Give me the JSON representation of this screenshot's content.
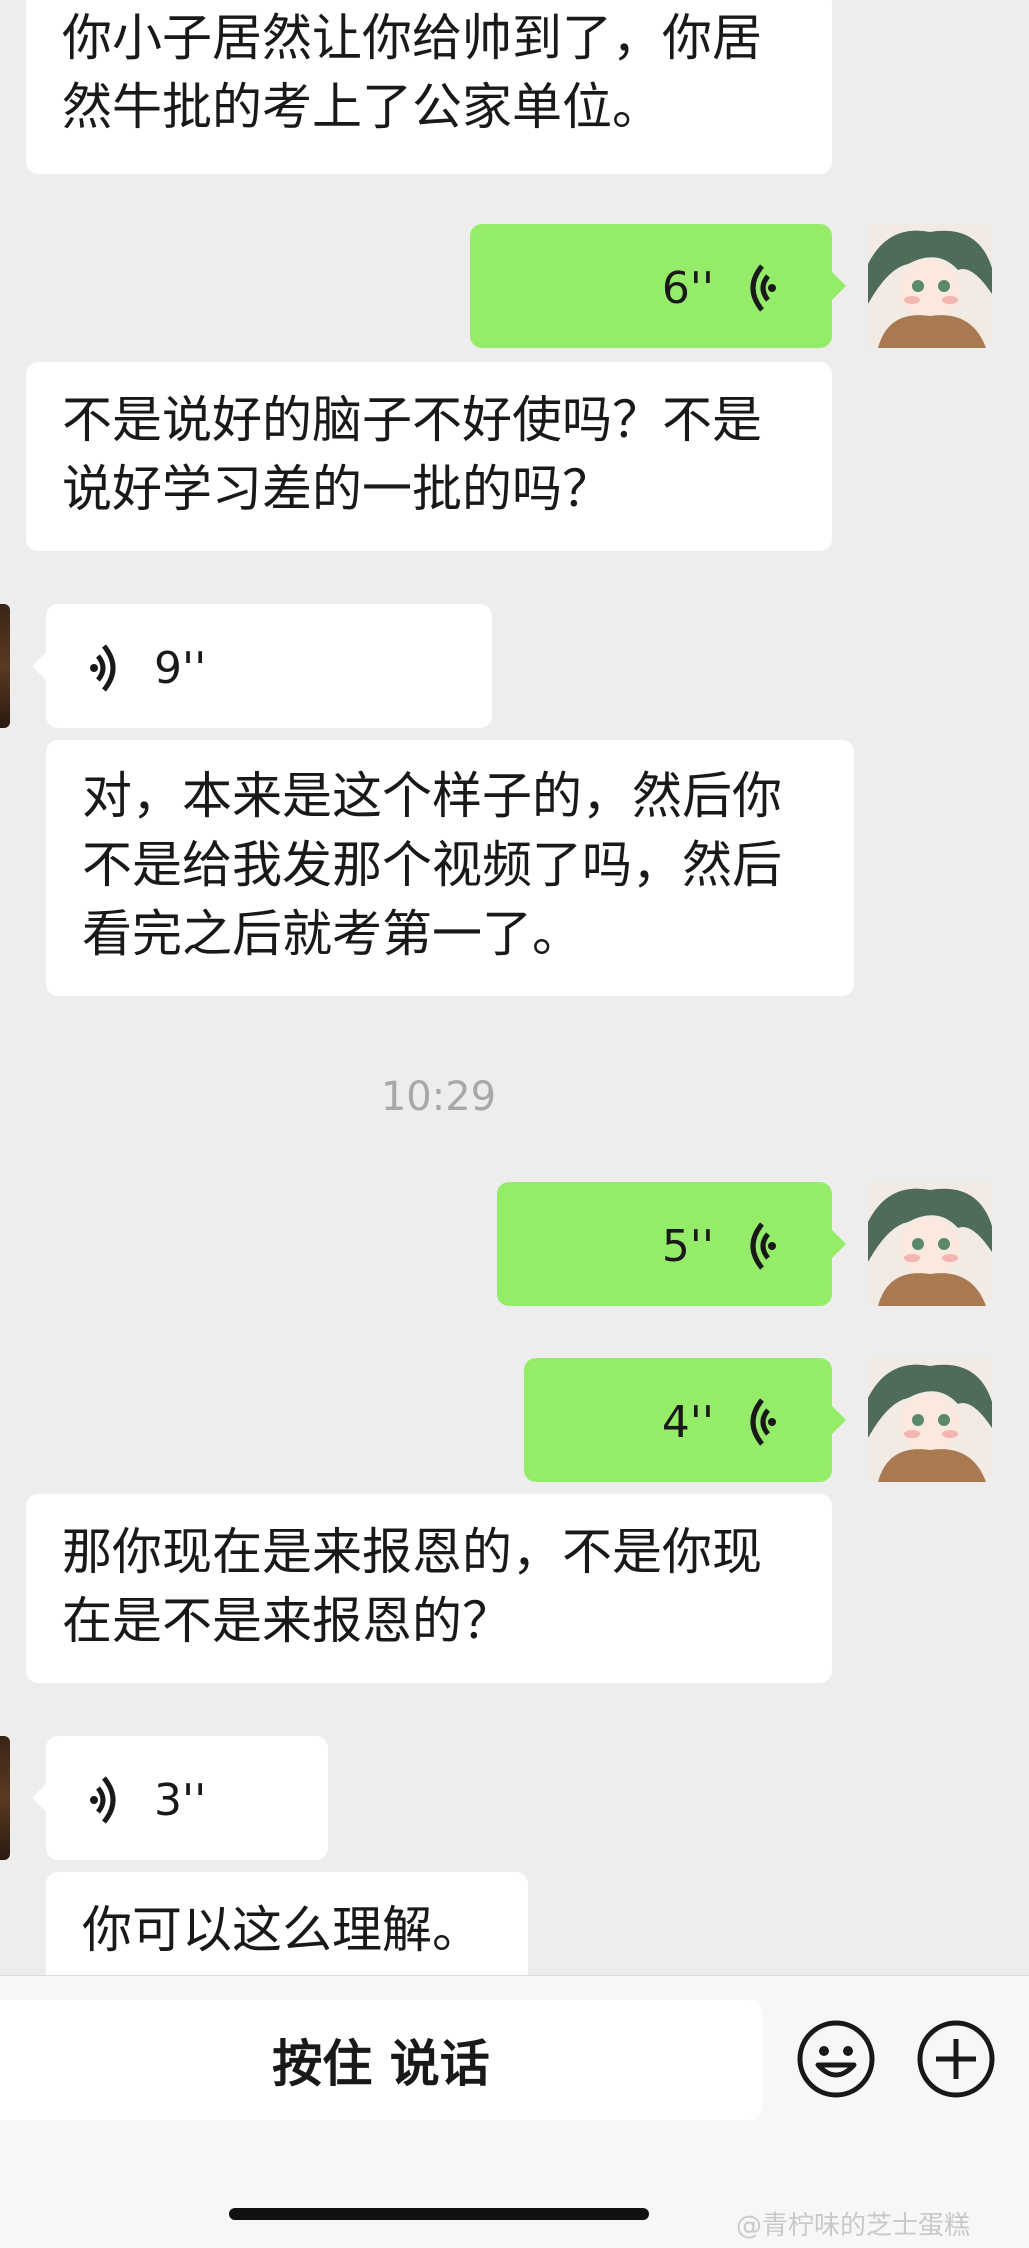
{
  "messages": {
    "m1": "你小子居然让你给帅到了，你居然牛批的考上了公家单位。",
    "m1_line1": "你小子居然让你给帅到了，你居",
    "m1_line2": "然牛批的考上了公家单位。",
    "voice_out_1": "6''",
    "m2_line1": "不是说好的脑子不好使吗？不是",
    "m2_line2": "说好学习差的一批的吗？",
    "voice_in_1": "9''",
    "m3_line1": "对，本来是这个样子的，然后你",
    "m3_line2": "不是给我发那个视频了吗，然后",
    "m3_line3": "看完之后就考第一了。",
    "timestamp": "10:29",
    "voice_out_2": "5''",
    "voice_out_3": "4''",
    "m4_line1": "那你现在是来报恩的，不是你现",
    "m4_line2": "在是不是来报恩的？",
    "voice_in_2": "3''",
    "m5_line1": "你可以这么理解。"
  },
  "toolbar": {
    "talk_label": "按住 说话",
    "emoji_icon": "smiley-icon",
    "plus_icon": "plus-icon"
  },
  "watermark": "@青柠味的芝士蛋糕",
  "colors": {
    "background": "#ededed",
    "outgoing_bubble": "#95ec69",
    "incoming_bubble": "#ffffff"
  }
}
